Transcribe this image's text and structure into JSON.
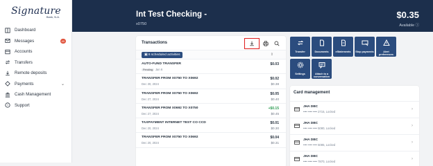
{
  "logo": {
    "text": "Signature",
    "sub": "Bank, N.A."
  },
  "sidebar": {
    "items": [
      {
        "label": "Dashboard",
        "icon": "dashboard-icon"
      },
      {
        "label": "Messages",
        "icon": "envelope-icon",
        "badge": "40"
      },
      {
        "label": "Accounts",
        "icon": "accounts-icon"
      },
      {
        "label": "Transfers",
        "icon": "transfer-icon"
      },
      {
        "label": "Remote deposits",
        "icon": "remote-deposit-icon"
      },
      {
        "label": "Payments",
        "icon": "payments-icon",
        "chevron": "⌄"
      },
      {
        "label": "Cash Management",
        "icon": "cash-management-icon"
      },
      {
        "label": "Support",
        "icon": "support-icon"
      }
    ]
  },
  "account": {
    "title": "Int Test Checking",
    "title_suffix": " -",
    "number": "x0750",
    "balance": "$0.35",
    "available_label": "Available ⓘ"
  },
  "transactions": {
    "title": "Transactions",
    "scheduled_label": "6 scheduled activities",
    "rows": [
      {
        "desc": "AUTO-FUND TRANSFER",
        "status": "Pending",
        "date": "Jan 6",
        "amount": "$0.03",
        "balance": "",
        "positive": false
      },
      {
        "desc": "TRANSFER FROM X0750 TO X0692",
        "status": "",
        "date": "Dec 30, 2024",
        "amount": "$0.02",
        "balance": "$0.38",
        "positive": false
      },
      {
        "desc": "TRANSFER FROM X0750 TO X0692",
        "status": "",
        "date": "Dec 27, 2024",
        "amount": "$0.05",
        "balance": "$0.40",
        "positive": false
      },
      {
        "desc": "TRANSFER FROM X0692 TO X0750",
        "status": "",
        "date": "Dec 27, 2024",
        "amount": "+$0.15",
        "balance": "$0.45",
        "positive": true
      },
      {
        "desc": "TAXPAYMENT INTERNET TEST CO CCD",
        "status": "",
        "date": "Dec 20, 2024",
        "amount": "$0.01",
        "balance": "$0.30",
        "positive": false
      },
      {
        "desc": "TRANSFER FROM X0750 TO X0692",
        "status": "",
        "date": "Dec 20, 2024",
        "amount": "$0.04",
        "balance": "$0.31",
        "positive": false
      }
    ]
  },
  "actions": [
    {
      "label": "Transfer",
      "icon": "transfer-arrows-icon"
    },
    {
      "label": "Documents",
      "icon": "document-icon"
    },
    {
      "label": "eStatements",
      "icon": "estatement-icon"
    },
    {
      "label": "Stop payments",
      "icon": "stop-payment-icon"
    },
    {
      "label": "Alert preferences",
      "icon": "alert-icon"
    },
    {
      "label": "Settings",
      "icon": "gear-icon"
    },
    {
      "label": "Attach to a conversation",
      "icon": "chat-icon"
    }
  ],
  "card_management": {
    "title": "Card management",
    "cards": [
      {
        "name": "JHA DBC",
        "detail": "•••• •••• •••• 2715, Locked"
      },
      {
        "name": "JHA DBC",
        "detail": "•••• •••• •••• 5080, Locked"
      },
      {
        "name": "JHA DBC",
        "detail": "•••• •••• •••• 5085, Locked"
      },
      {
        "name": "JHA DBC",
        "detail": "•••• •••• •••• 7870, Locked"
      }
    ]
  },
  "colors": {
    "header_bg": "#1c2f4c",
    "button_bg": "#2b4c7e",
    "positive": "#2d9b52",
    "badge": "#e0533c",
    "highlight": "#e01b1b"
  }
}
